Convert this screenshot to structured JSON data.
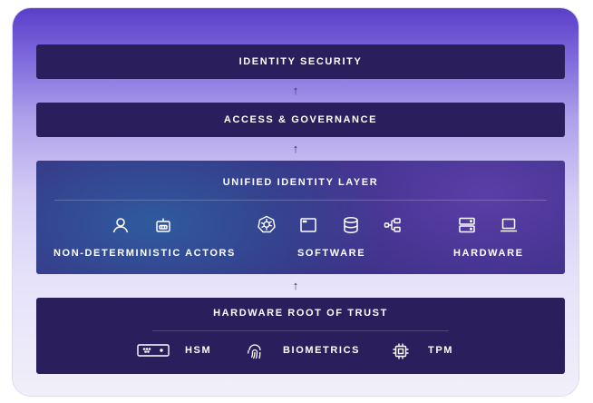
{
  "layers": {
    "identity_security": "IDENTITY SECURITY",
    "access_governance": "ACCESS & GOVERNANCE",
    "unified_identity": "UNIFIED IDENTITY LAYER",
    "root_of_trust": "HARDWARE ROOT OF TRUST"
  },
  "groups": {
    "actors": "NON-DETERMINISTIC ACTORS",
    "software": "SOFTWARE",
    "hardware": "HARDWARE"
  },
  "root_items": {
    "hsm": "HSM",
    "biometrics": "BIOMETRICS",
    "tpm": "TPM"
  },
  "arrow_glyph": "↑",
  "colors": {
    "band": "#2a1f5c",
    "unified": "#3a2f82",
    "text": "#ffffff"
  }
}
